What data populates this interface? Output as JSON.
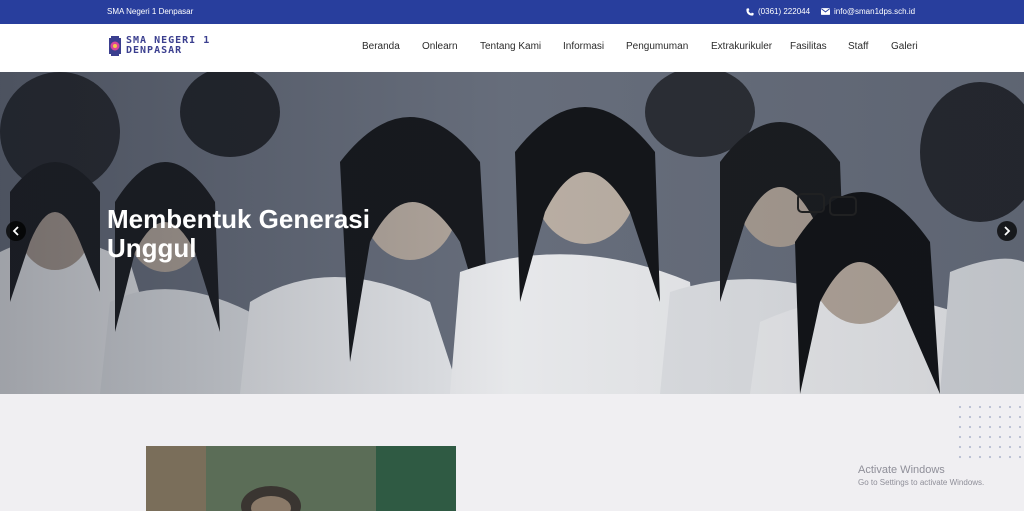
{
  "topbar": {
    "school_name": "SMA Negeri 1 Denpasar",
    "phone": "(0361) 222044",
    "email": "info@sman1dps.sch.id"
  },
  "logo": {
    "line1": "SMA NEGERI 1",
    "line2": "DENPASAR"
  },
  "nav": {
    "items": [
      "Beranda",
      "Onlearn",
      "Tentang Kami",
      "Informasi",
      "Pengumuman",
      "Extrakurikuler",
      "Fasilitas",
      "Staff",
      "Galeri"
    ]
  },
  "hero": {
    "heading": "Membentuk Generasi Unggul",
    "prev_icon": "chevron-left-icon",
    "next_icon": "chevron-right-icon"
  },
  "watermark": {
    "title": "Activate Windows",
    "subtitle": "Go to Settings to activate Windows."
  },
  "colors": {
    "topbar": "#283e9d",
    "brand": "#3b3f8f",
    "content_bg": "#f0eff2"
  }
}
